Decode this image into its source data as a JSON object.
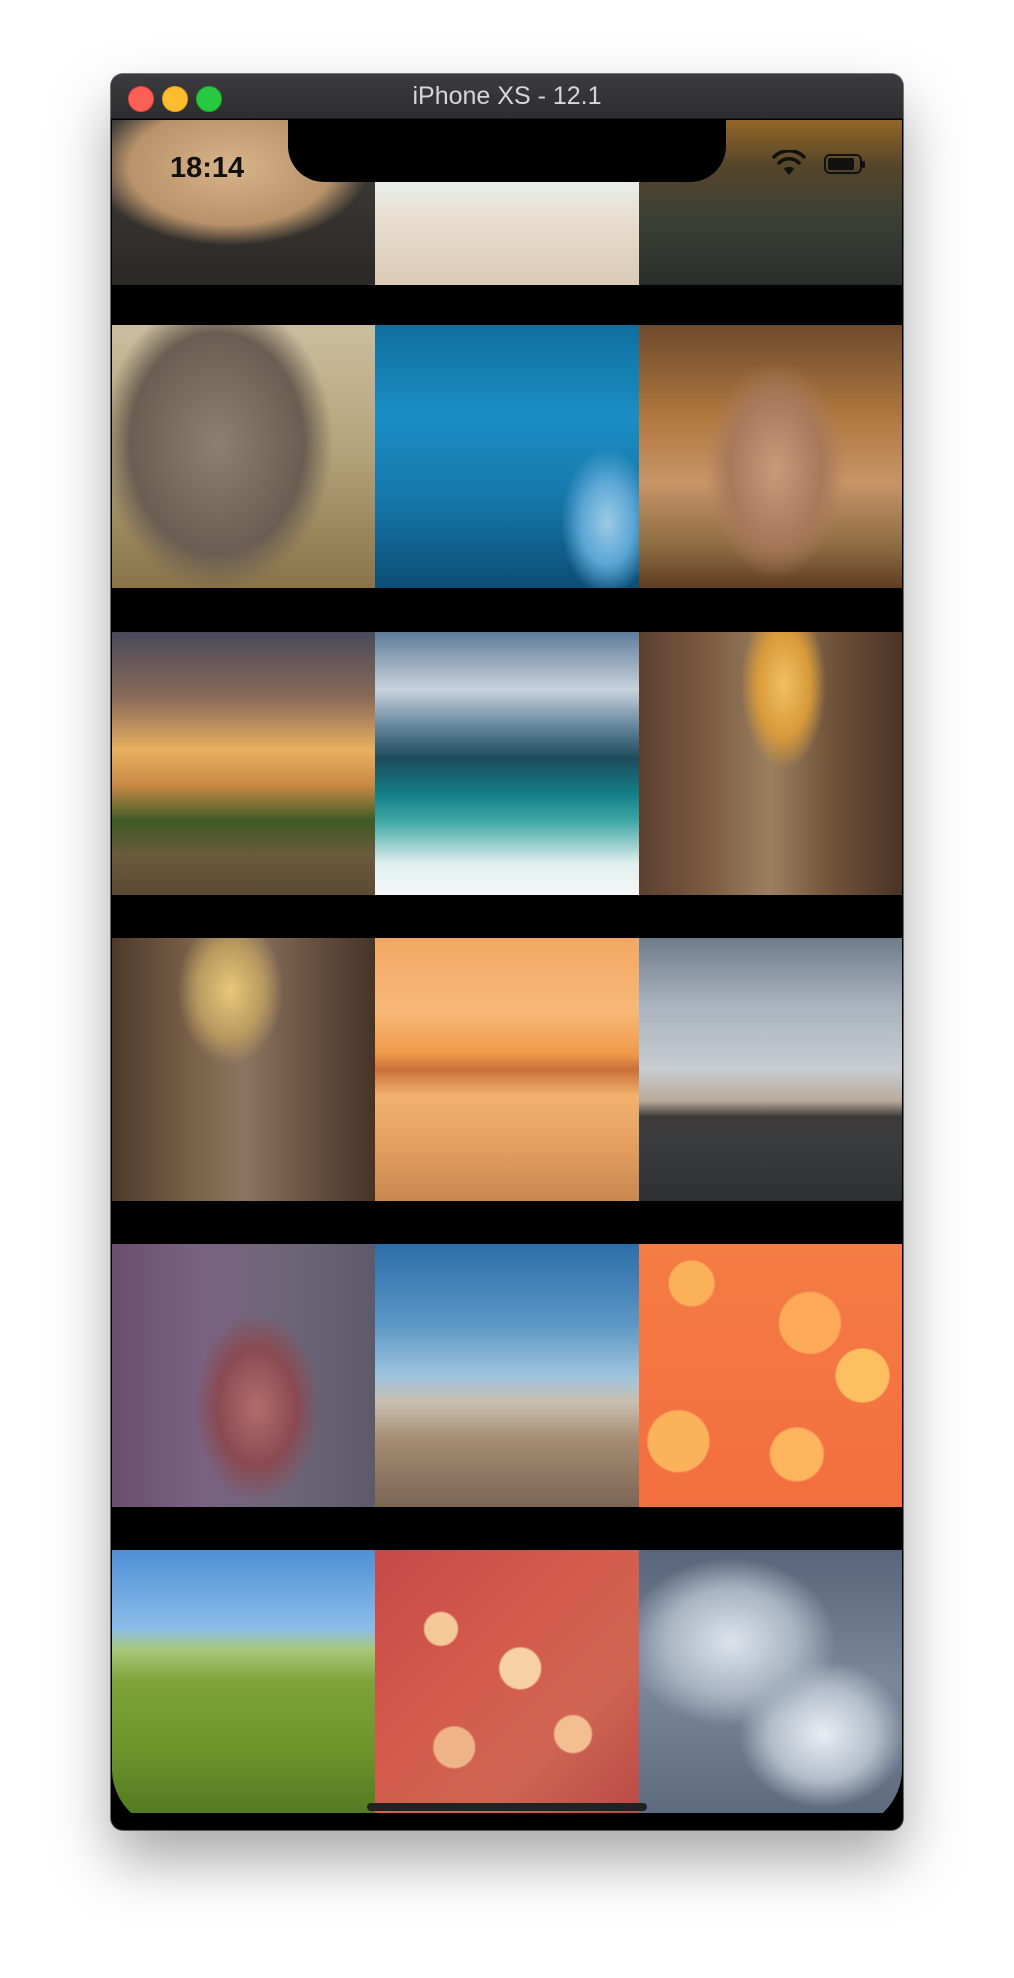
{
  "window": {
    "title": "iPhone XS - 12.1"
  },
  "status_bar": {
    "time": "18:14"
  },
  "gallery": {
    "rows": [
      [
        "lion",
        "wave-beach",
        "lake-sunset"
      ],
      [
        "horse",
        "dolphin",
        "mountain"
      ],
      [
        "field-storm",
        "ocean-waves",
        "canyon"
      ],
      [
        "canyon-dino",
        "pier-sunset",
        "city-skyline"
      ],
      [
        "deer",
        "coastal-city",
        "bokeh-orange"
      ],
      [
        "meadow",
        "bokeh-red",
        "storm-clouds"
      ]
    ]
  },
  "icons": [
    "wifi-icon",
    "battery-icon"
  ],
  "colors": {
    "close": "#fe5f57",
    "minimize": "#febc2e",
    "zoom": "#28c840",
    "screen_bg": "#000000"
  }
}
